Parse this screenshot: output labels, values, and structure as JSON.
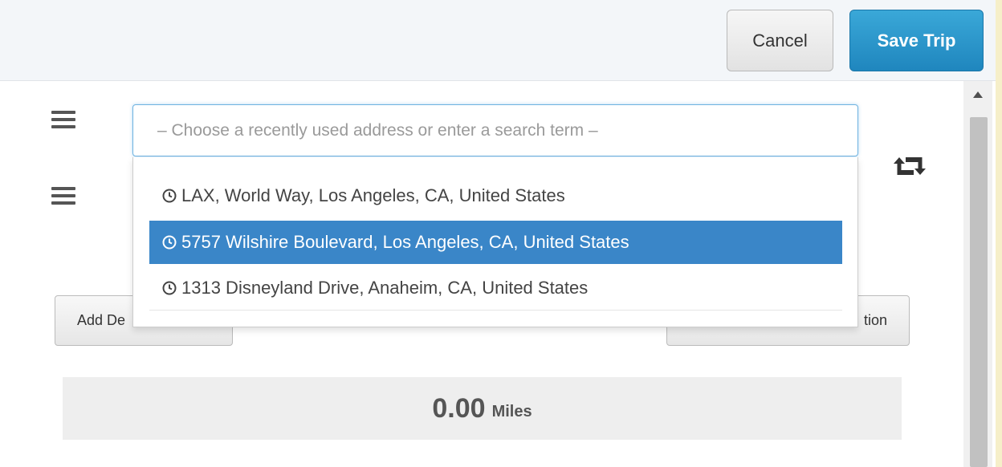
{
  "header": {
    "cancel_label": "Cancel",
    "save_label": "Save Trip"
  },
  "search": {
    "placeholder": "– Choose a recently used address or enter a search term –"
  },
  "dropdown": {
    "items": [
      {
        "label": "LAX, World Way, Los Angeles, CA, United States",
        "icon": "clock-icon",
        "selected": false
      },
      {
        "label": "5757 Wilshire Boulevard, Los Angeles, CA, United States",
        "icon": "clock-icon",
        "selected": true
      },
      {
        "label": "1313 Disneyland Drive, Anaheim, CA, United States",
        "icon": "clock-icon",
        "selected": false
      }
    ]
  },
  "actions": {
    "add_destination_label": "Add De",
    "right_button_label": "tion"
  },
  "summary": {
    "miles_value": "0.00",
    "miles_unit": "Miles"
  },
  "colors": {
    "accent": "#2590c6",
    "selected_row": "#3a86c8",
    "header_bg": "#f3f6f9"
  }
}
